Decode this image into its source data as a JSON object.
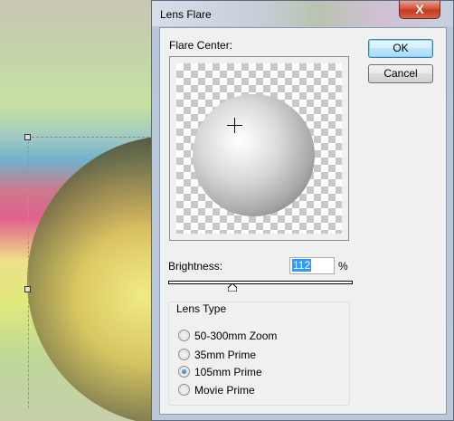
{
  "window": {
    "title": "Lens Flare",
    "close_glyph": "X"
  },
  "dialog": {
    "flare_center_label": "Flare Center:",
    "ok_label": "OK",
    "cancel_label": "Cancel",
    "brightness_label": "Brightness:",
    "brightness_value": "112",
    "brightness_unit": "%",
    "brightness_slider_fraction": 0.35,
    "lens_type_label": "Lens Type",
    "lens_types": [
      {
        "label": "50-300mm Zoom",
        "checked": false
      },
      {
        "label": "35mm Prime",
        "checked": false
      },
      {
        "label": "105mm Prime",
        "checked": true
      },
      {
        "label": "Movie Prime",
        "checked": false
      }
    ]
  },
  "colors": {
    "selection": "#3399ff",
    "close_button": "#c23a20",
    "default_button_border": "#3c7fb1"
  }
}
